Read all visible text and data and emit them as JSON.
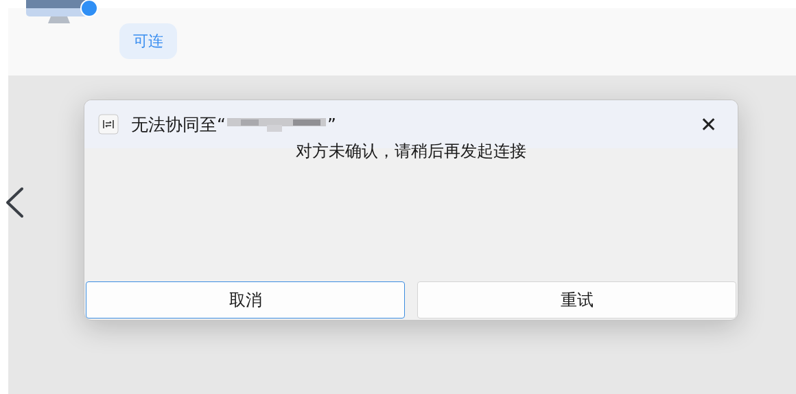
{
  "device_card": {
    "status_badge": "可连",
    "online": true
  },
  "dialog": {
    "title_before_name": "无法协同至“",
    "title_after_name": "”",
    "close": "✕",
    "message": "对方未确认，请稍后再发起连接",
    "buttons": [
      {
        "label": "取消",
        "selected": true
      },
      {
        "label": "重试",
        "selected": false
      }
    ]
  }
}
